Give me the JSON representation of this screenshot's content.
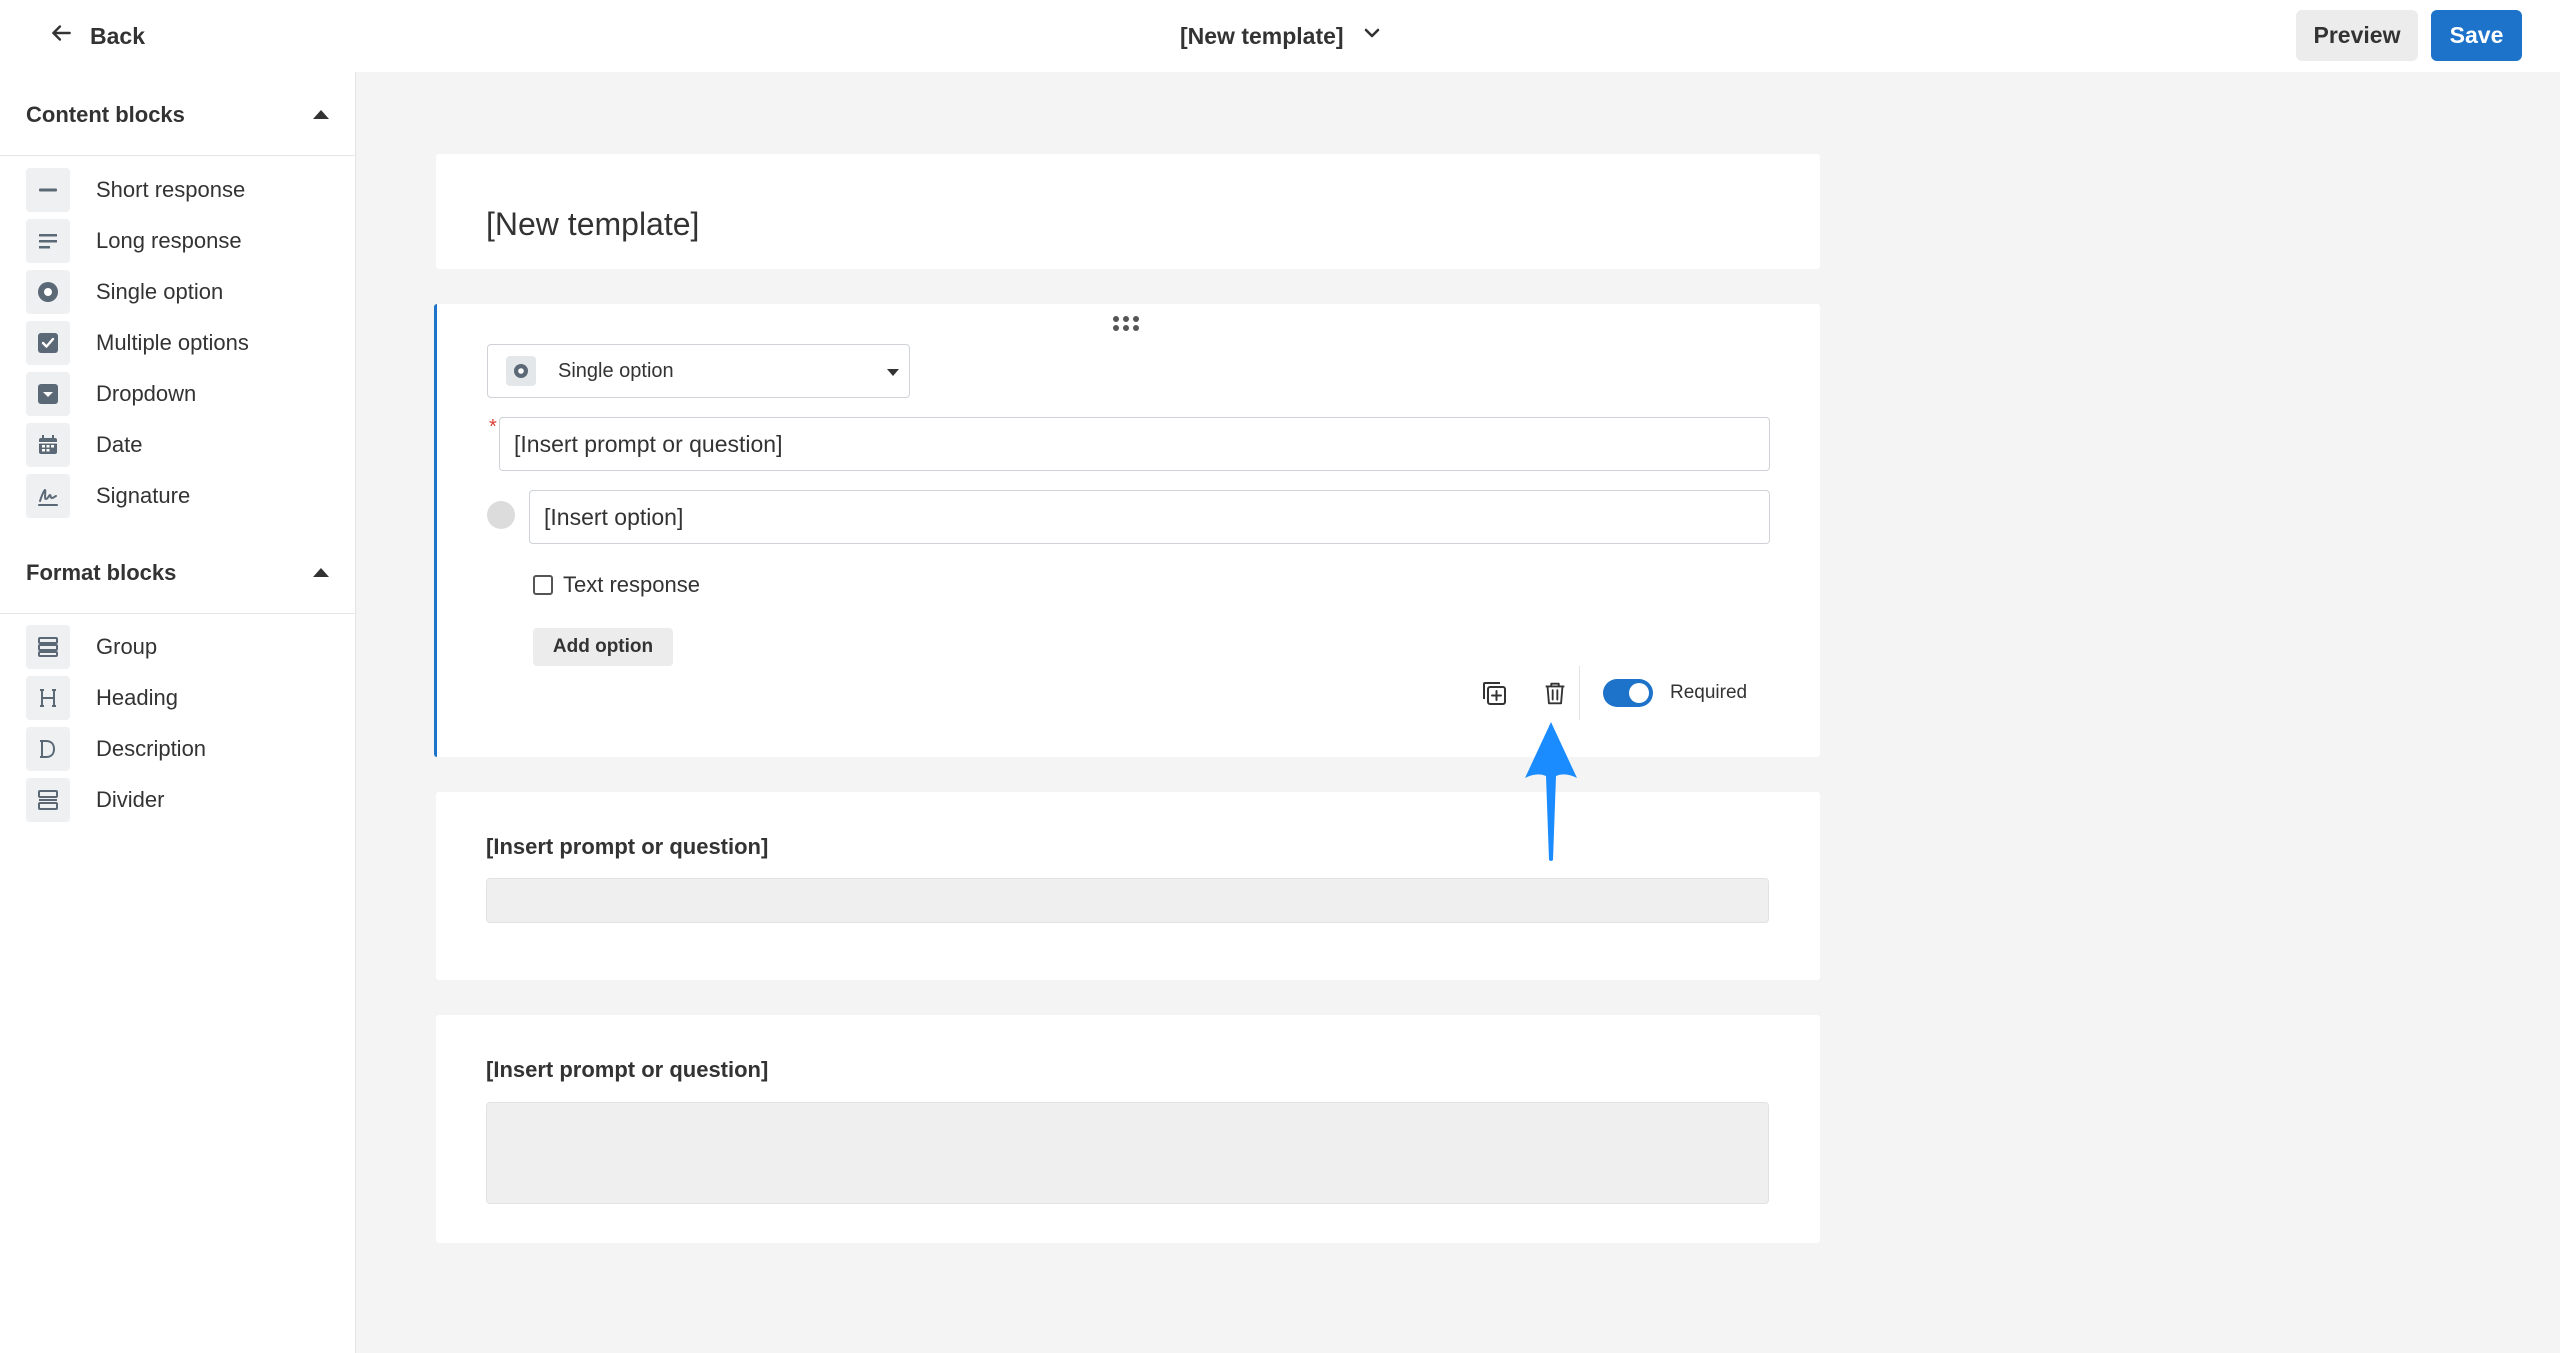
{
  "topbar": {
    "back_label": "Back",
    "template_title": "[New template]",
    "preview_label": "Preview",
    "save_label": "Save"
  },
  "sidebar": {
    "content_blocks_title": "Content blocks",
    "content_items": [
      {
        "label": "Short response",
        "icon": "short-response-icon"
      },
      {
        "label": "Long response",
        "icon": "long-response-icon"
      },
      {
        "label": "Single option",
        "icon": "radio-icon"
      },
      {
        "label": "Multiple options",
        "icon": "checkbox-icon"
      },
      {
        "label": "Dropdown",
        "icon": "dropdown-icon"
      },
      {
        "label": "Date",
        "icon": "calendar-icon"
      },
      {
        "label": "Signature",
        "icon": "signature-icon"
      }
    ],
    "format_blocks_title": "Format blocks",
    "format_items": [
      {
        "label": "Group",
        "icon": "group-icon"
      },
      {
        "label": "Heading",
        "icon": "heading-icon"
      },
      {
        "label": "Description",
        "icon": "description-icon"
      },
      {
        "label": "Divider",
        "icon": "divider-icon"
      }
    ]
  },
  "main": {
    "template_heading": "[New template]",
    "active_block": {
      "type_label": "Single option",
      "prompt_value": "[Insert prompt or question]",
      "option_value": "[Insert option]",
      "text_response_label": "Text response",
      "text_response_checked": false,
      "add_option_label": "Add option",
      "required_label": "Required",
      "required_on": true
    },
    "block_2": {
      "prompt": "[Insert prompt or question]"
    },
    "block_3": {
      "prompt": "[Insert prompt or question]"
    }
  },
  "colors": {
    "accent": "#1d73c9",
    "arrow": "#1a8cff",
    "required_star": "#e03c31"
  }
}
